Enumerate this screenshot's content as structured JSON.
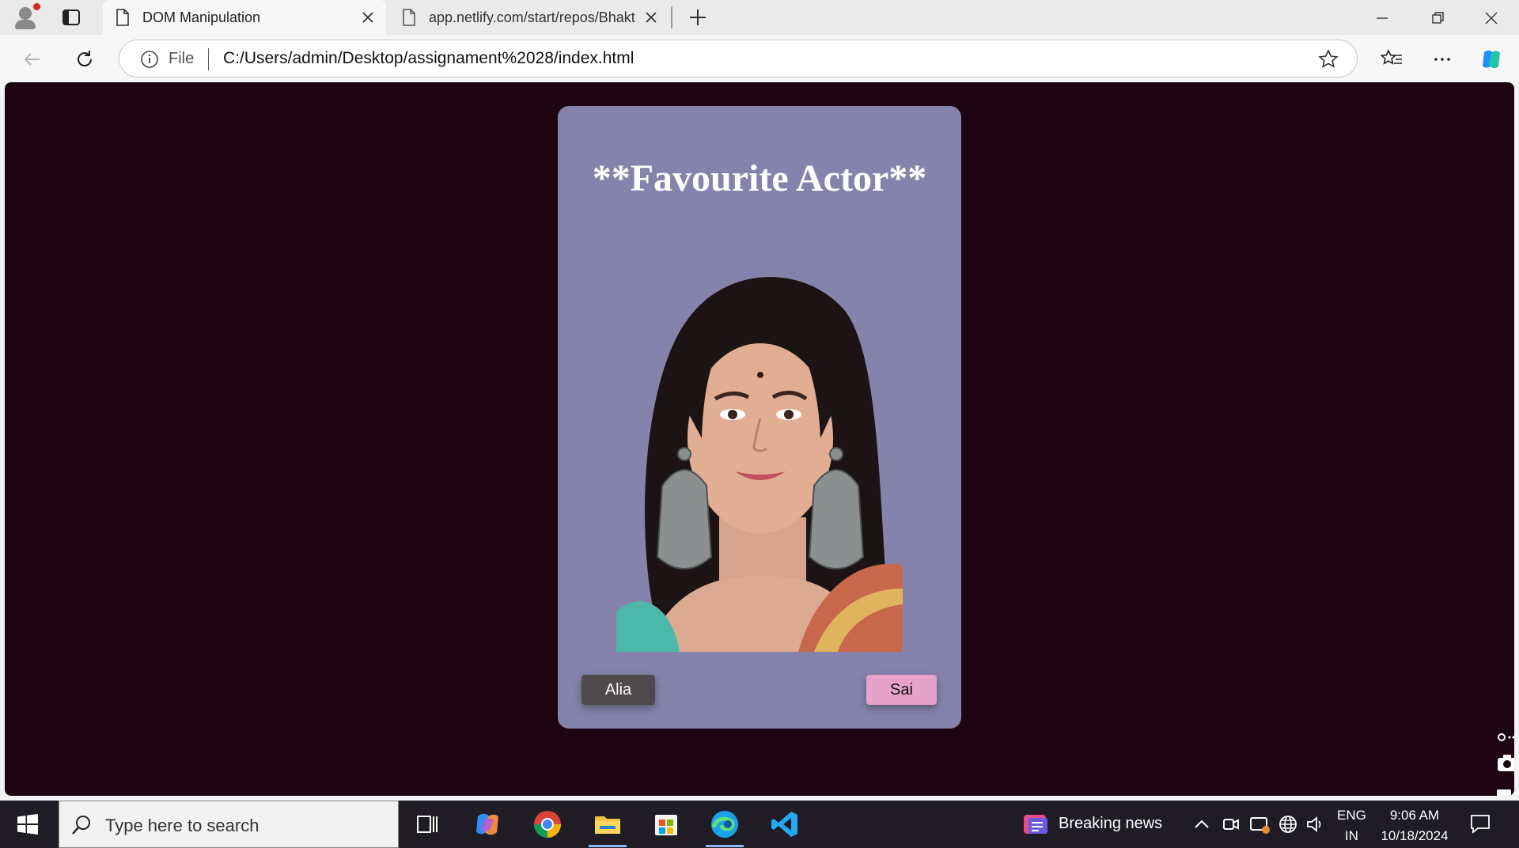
{
  "browser": {
    "tabs": [
      {
        "title": "DOM Manipulation",
        "active": true
      },
      {
        "title": "app.netlify.com/start/repos/Bhakt",
        "active": false
      }
    ],
    "address_bar": {
      "scheme_label": "File",
      "url": "C:/Users/admin/Desktop/assignament%2028/index.html"
    }
  },
  "page": {
    "background": "#1d0411",
    "card_color": "#8583ab",
    "heading": "**Favourite Actor**",
    "buttons": {
      "left": {
        "label": "Alia",
        "color": "#4e4a4c"
      },
      "right": {
        "label": "Sai",
        "color": "#e7a2c9"
      }
    },
    "portrait_icon": "actor-portrait-photo"
  },
  "taskbar": {
    "search_placeholder": "Type here to search",
    "news_label": "Breaking news",
    "language_top": "ENG",
    "language_bottom": "IN",
    "time": "9:06 AM",
    "date": "10/18/2024"
  }
}
